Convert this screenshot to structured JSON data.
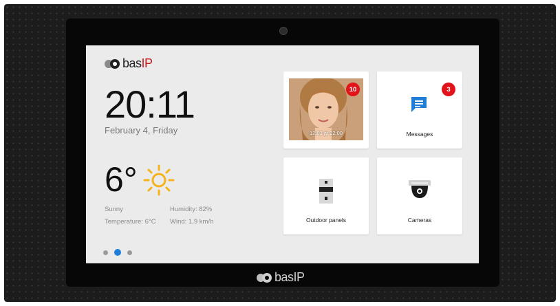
{
  "brand": {
    "name_main": "bas",
    "name_accent": "IP"
  },
  "clock": {
    "time": "20:11",
    "date": "February 4, Friday"
  },
  "weather": {
    "temperature": "6°",
    "condition": "Sunny",
    "temperature_line": "Temperature: 6°C",
    "humidity": "Humidity: 82%",
    "wind": "Wind: 1,9 km/h",
    "icon": "sun-icon"
  },
  "pager": {
    "count": 3,
    "active_index": 1
  },
  "tiles": {
    "visitors": {
      "badge": "10",
      "timestamp": "12.03 at 22:00",
      "icon": "visitor-photo"
    },
    "messages": {
      "label": "Messages",
      "badge": "3",
      "icon": "message-icon"
    },
    "outdoor": {
      "label": "Outdoor panels",
      "icon": "outdoor-panel-icon"
    },
    "cameras": {
      "label": "Cameras",
      "icon": "camera-icon"
    }
  },
  "colors": {
    "accent_blue": "#1e7ed8",
    "badge_red": "#e1141b",
    "sun_yellow": "#f5b21b",
    "brand_red": "#d0161b"
  }
}
